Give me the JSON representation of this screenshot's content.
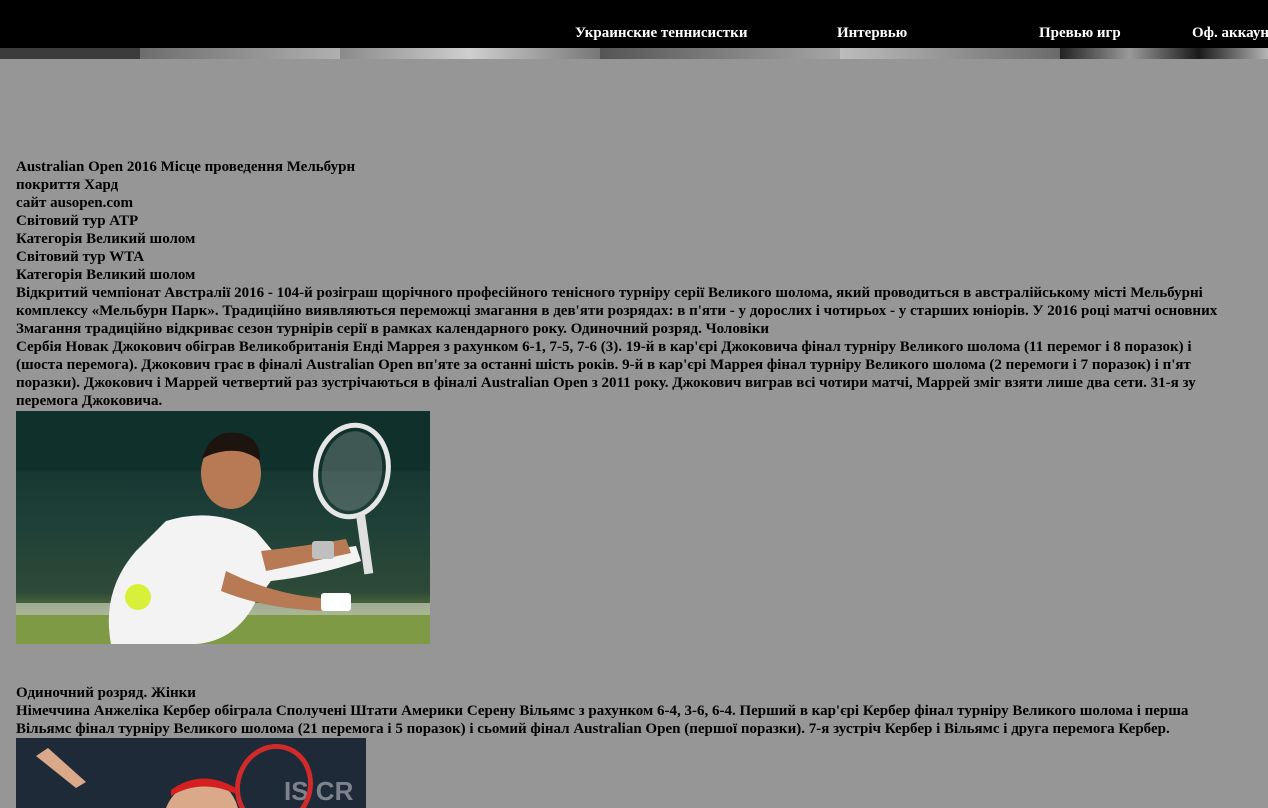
{
  "nav": {
    "items": [
      {
        "label": "Украинские теннисистки"
      },
      {
        "label": "Интервью"
      },
      {
        "label": "Превью игр"
      },
      {
        "label": "Оф. аккаунты"
      }
    ]
  },
  "article": {
    "info_lines": [
      "Australian Open 2016 Місце проведення Мельбурн",
      "покриття Хард",
      "сайт ausopen.com",
      "Світовий тур ATP",
      "Категорія Великий шолом",
      "Світовий тур WTA",
      "Категорія Великий шолом"
    ],
    "intro_lines": [
      "Відкритий чемпіонат Австралії 2016 - 104-й розіграш щорічного професійного тенісного турніру серії Великого шолома, який проводиться в австралійському місті Мельбурні",
      "комплексу «Мельбурн Парк». Традиційно виявляються переможці змагання в дев'яти розрядах: в п'яти - у дорослих і чотирьох - у старших юніорів. У 2016 році матчі основних",
      "Змагання традиційно відкриває сезон турнірів серії в рамках календарного року. Одиночний розряд. Чоловіки"
    ],
    "men_lines": [
      "Сербія Новак Джокович обіграв Великобританія Енді Маррея з рахунком 6-1, 7-5, 7-6 (3). 19-й в кар'єрі Джоковича фінал турніру Великого шолома (11 перемог і 8 поразок) і",
      "(шоста перемога). Джокович грає в фіналі Australian Open вп'яте за останні шість років. 9-й в кар'єрі Маррея фінал турніру Великого шолома (2 перемоги і 7 поразок) і п'ят",
      "поразки). Джокович і Маррей четвертий раз зустрічаються в фіналі Australian Open з 2011 року. Джокович виграв всі чотири матчі, Маррей зміг взяти лише два сети. 31-я зу",
      "перемога Джоковича."
    ],
    "women_heading": "Одиночний розряд. Жінки",
    "women_lines": [
      "Німеччина Анжеліка Кербер обіграла Сполучені Штати Америки Серену Вільямс з рахунком 6-4, 3-6, 6-4. Перший в кар'єрі Кербер фінал турніру Великого шолома і перша",
      "Вільямс фінал турніру Великого шолома (21 перемога і 5 поразок) і сьомий фінал Australian Open (першої поразки). 7-я зустріч Кербер і Вільямс і друга перемога Кербер."
    ],
    "photo2_banner_text": "IS CR"
  }
}
